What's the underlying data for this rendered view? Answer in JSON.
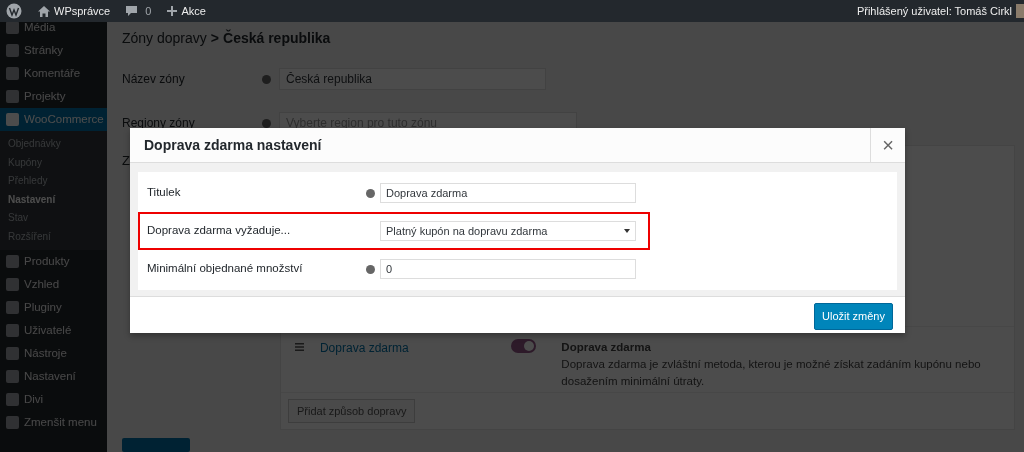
{
  "admin_bar": {
    "site_name": "WPsprávce",
    "comments_count": "0",
    "new_label": "Akce",
    "user_greeting": "Přihlášený uživatel: Tomáš Cirkl"
  },
  "sidebar": {
    "items": [
      {
        "label": "Média",
        "selected": false
      },
      {
        "label": "Stránky",
        "selected": false
      },
      {
        "label": "Komentáře",
        "selected": false
      },
      {
        "label": "Projekty",
        "selected": false
      },
      {
        "label": "WooCommerce",
        "selected": true,
        "children": [
          {
            "label": "Objednávky",
            "selected": false
          },
          {
            "label": "Kupóny",
            "selected": false
          },
          {
            "label": "Přehledy",
            "selected": false
          },
          {
            "label": "Nastavení",
            "selected": true
          },
          {
            "label": "Stav",
            "selected": false
          },
          {
            "label": "Rozšíření",
            "selected": false
          }
        ]
      },
      {
        "label": "Produkty",
        "selected": false
      },
      {
        "label": "Vzhled",
        "selected": false
      },
      {
        "label": "Pluginy",
        "selected": false
      },
      {
        "label": "Uživatelé",
        "selected": false
      },
      {
        "label": "Nástroje",
        "selected": false
      },
      {
        "label": "Nastavení",
        "selected": false
      },
      {
        "label": "Divi",
        "selected": false
      },
      {
        "label": "Zmenšit menu",
        "selected": false
      }
    ]
  },
  "breadcrumb": {
    "link": "Zóny dopravy",
    "separator": ">",
    "current": "Česká republika"
  },
  "zone_form": [
    {
      "label": "Název zóny",
      "value": "Česká republika"
    },
    {
      "label": "Regiony zóny",
      "placeholder": "Vyberte region pro tuto zónu"
    }
  ],
  "methods_section": {
    "label": "Z",
    "methods": [
      {
        "name": "Doprava zdarma",
        "on": true,
        "description_title": "Doprava zdarma",
        "description": "Doprava zdarma je zvláštní metoda, kterou je možné získat zadáním kupónu nebo dosažením minimální útraty."
      }
    ],
    "add_button": "Přidat způsob dopravy"
  },
  "modal": {
    "title": "Doprava zdarma nastavení",
    "close": "×",
    "fields": [
      {
        "kind": "text",
        "label": "Titulek",
        "value": "Doprava zdarma",
        "help": true,
        "highlighted": false
      },
      {
        "kind": "select",
        "label": "Doprava zdarma vyžaduje...",
        "value": "Platný kupón na dopravu zdarma",
        "help": false,
        "highlighted": true
      },
      {
        "kind": "text",
        "label": "Minimální objednané množství",
        "value": "0",
        "help": true,
        "highlighted": false
      }
    ],
    "save_button": "Uložit změny"
  }
}
